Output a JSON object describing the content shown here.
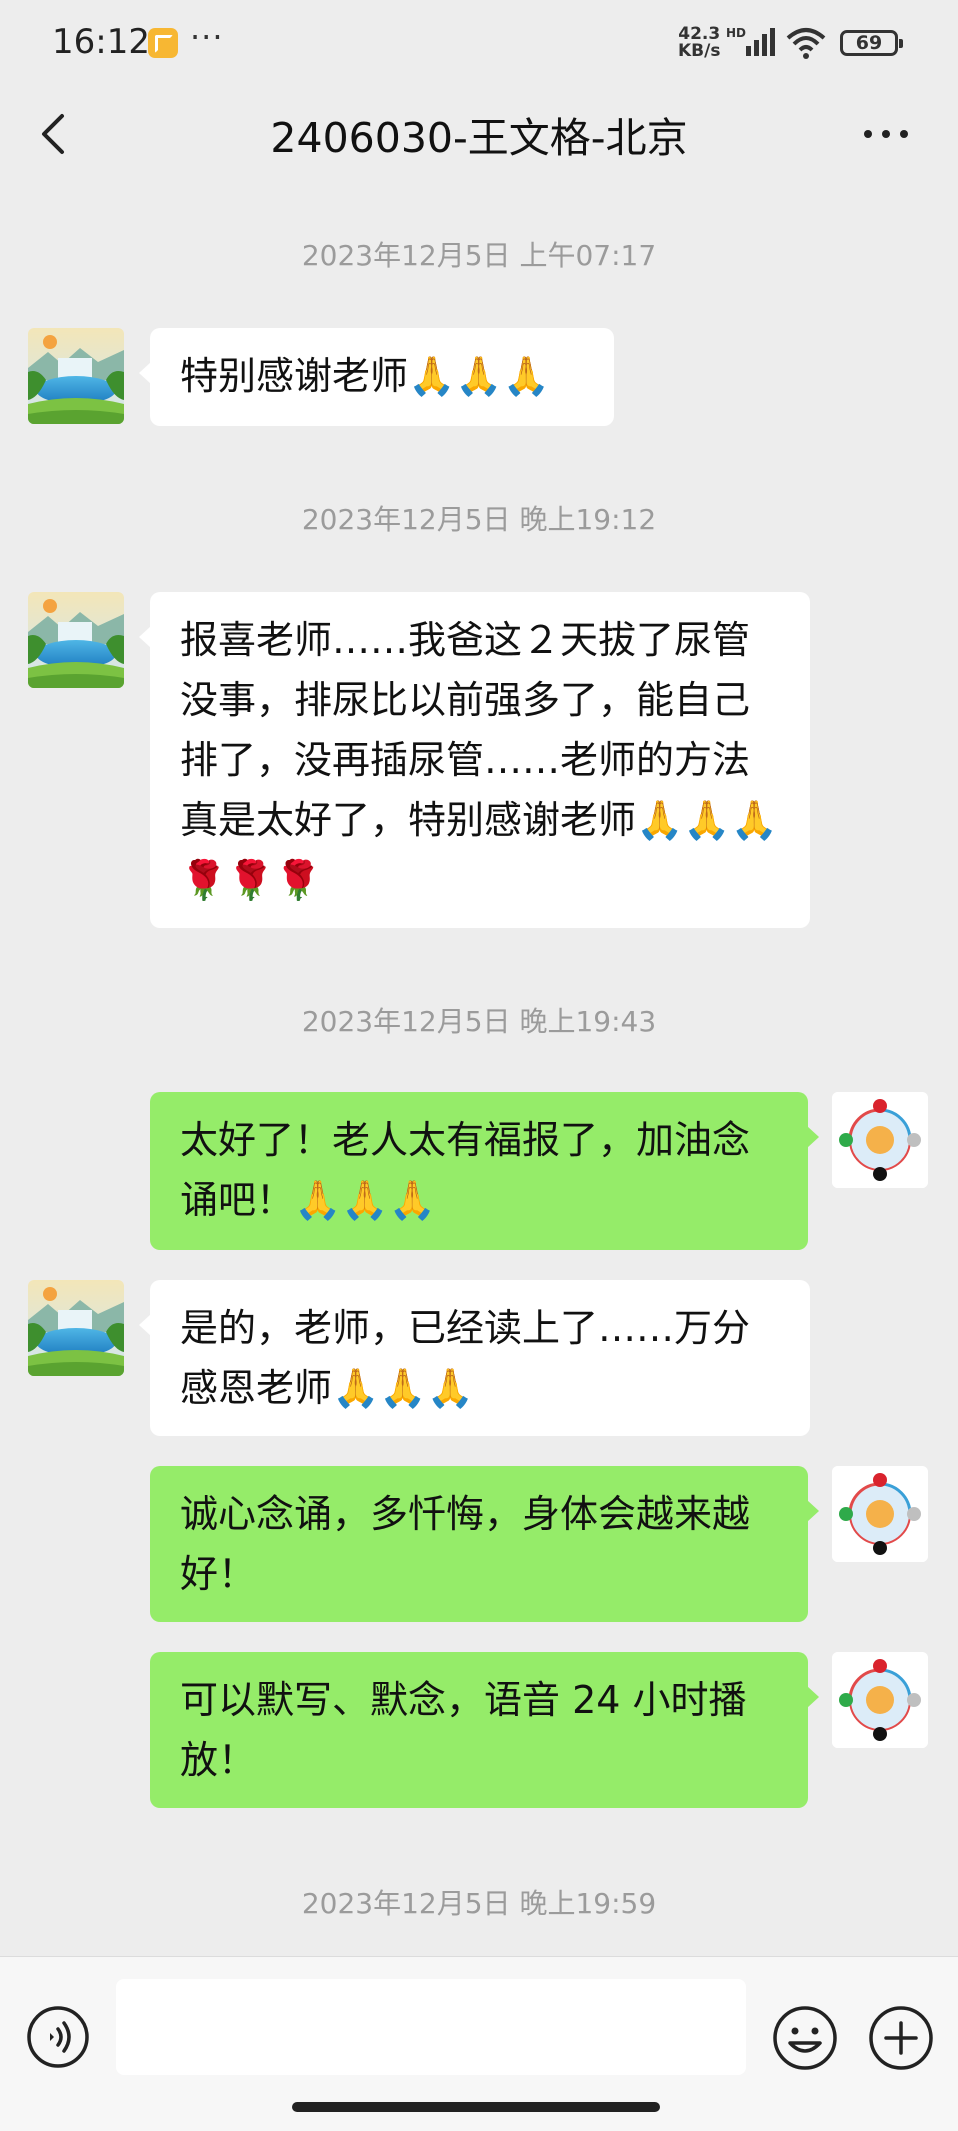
{
  "status_bar": {
    "time": "16:12",
    "dots": "···",
    "speed_value": "42.3",
    "speed_unit": "KB/s",
    "network_label": "HD",
    "battery": "69"
  },
  "header": {
    "title": "2406030-王文格-北京"
  },
  "messages": [
    {
      "timestamp": "2023年12月5日 上午07:17"
    },
    {
      "from": "contact",
      "text": "特别感谢老师🙏🙏🙏"
    },
    {
      "timestamp": "2023年12月5日 晚上19:12"
    },
    {
      "from": "contact",
      "text": "报喜老师……我爸这２天拔了尿管没事，排尿比以前强多了，能自己排了，没再插尿管……老师的方法真是太好了，特别感谢老师🙏🙏🙏🌹🌹🌹"
    },
    {
      "timestamp": "2023年12月5日 晚上19:43"
    },
    {
      "from": "me",
      "text": "太好了！老人太有福报了，加油念诵吧！🙏🙏🙏"
    },
    {
      "from": "contact",
      "text": "是的，老师，已经读上了……万分感恩老师🙏🙏🙏"
    },
    {
      "from": "me",
      "text": "诚心念诵，多忏悔，身体会越来越好！"
    },
    {
      "from": "me",
      "text": "可以默写、默念，语音 24 小时播放！"
    },
    {
      "timestamp": "2023年12月5日 晚上19:59"
    }
  ],
  "input": {
    "placeholder": ""
  },
  "colors": {
    "outgoing_bubble": "#95ec69",
    "incoming_bubble": "#ffffff",
    "background": "#ededed"
  },
  "icons": [
    "back-arrow-icon",
    "more-dots-icon",
    "voice-icon",
    "emoji-icon",
    "plus-icon"
  ]
}
